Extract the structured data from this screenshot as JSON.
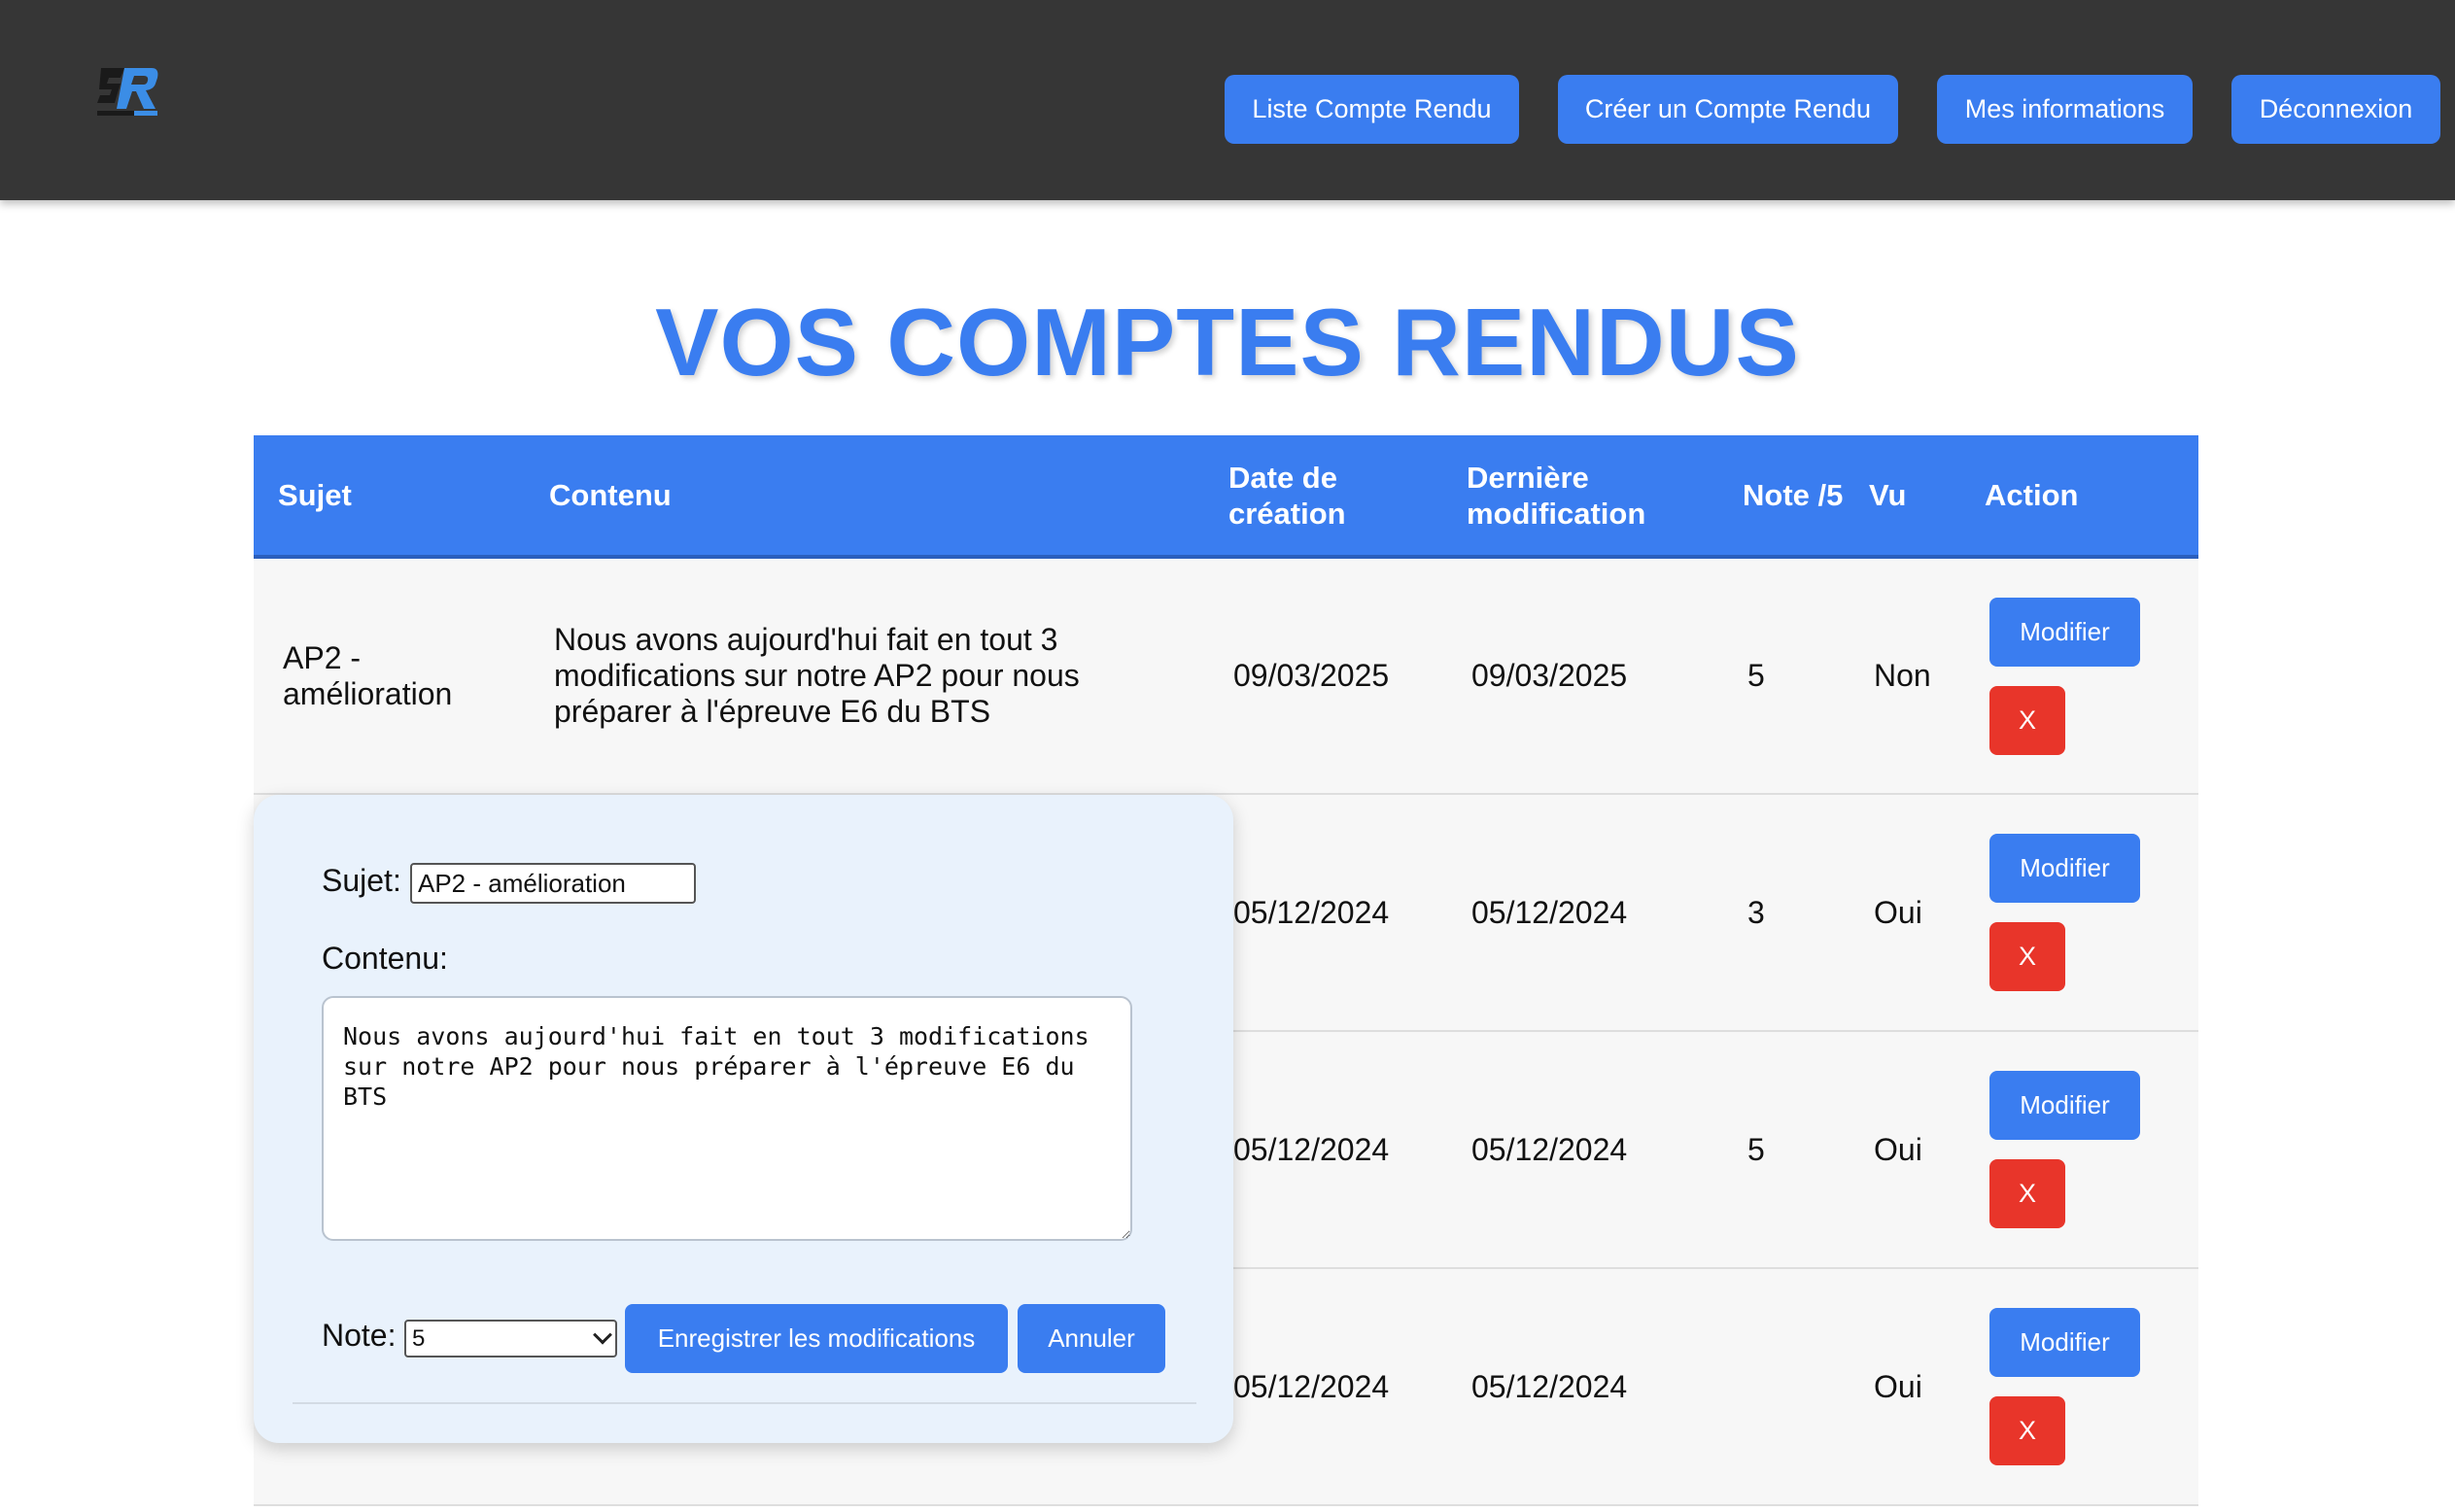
{
  "nav": {
    "logo_icon": "sr-logo-icon",
    "buttons": [
      {
        "label": "Liste Compte Rendu"
      },
      {
        "label": "Créer un Compte Rendu"
      },
      {
        "label": "Mes informations"
      },
      {
        "label": "Déconnexion"
      }
    ]
  },
  "page": {
    "title": "VOS COMPTES RENDUS"
  },
  "table": {
    "headers": {
      "sujet": "Sujet",
      "contenu": "Contenu",
      "date_creation": "Date de création",
      "derniere_modif": "Dernière modification",
      "note": "Note /5",
      "vu": "Vu",
      "action": "Action"
    },
    "rows": [
      {
        "sujet": "AP2 - amélioration",
        "contenu": "Nous avons aujourd'hui fait en tout 3 modifications sur notre AP2 pour nous préparer à l'épreuve E6 du BTS",
        "date_creation": "09/03/2025",
        "derniere_modif": "09/03/2025",
        "note": "5",
        "vu": "Non",
        "modifier": "Modifier",
        "delete": "X"
      },
      {
        "sujet": "",
        "contenu": "",
        "date_creation": "05/12/2024",
        "derniere_modif": "05/12/2024",
        "note": "3",
        "vu": "Oui",
        "modifier": "Modifier",
        "delete": "X"
      },
      {
        "sujet": "",
        "contenu": "",
        "date_creation": "05/12/2024",
        "derniere_modif": "05/12/2024",
        "note": "5",
        "vu": "Oui",
        "modifier": "Modifier",
        "delete": "X"
      },
      {
        "sujet": "",
        "contenu": "",
        "date_creation": "05/12/2024",
        "derniere_modif": "05/12/2024",
        "note": "",
        "vu": "Oui",
        "modifier": "Modifier",
        "delete": "X"
      }
    ]
  },
  "edit_form": {
    "sujet_label": "Sujet:",
    "sujet_value": "AP2 - amélioration",
    "contenu_label": "Contenu:",
    "contenu_value": "Nous avons aujourd'hui fait en tout 3 modifications sur notre AP2 pour nous préparer à l'épreuve E6 du BTS",
    "note_label": "Note:",
    "note_value": "5",
    "save_label": "Enregistrer les modifications",
    "cancel_label": "Annuler"
  },
  "colors": {
    "accent": "#3a7df0",
    "danger": "#e8352a",
    "topbar": "#363636",
    "panel": "#e9f2fc"
  }
}
